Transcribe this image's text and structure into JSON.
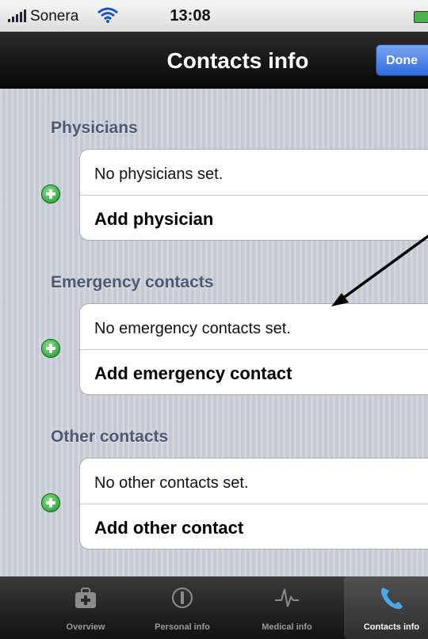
{
  "status_bar": {
    "carrier": "Sonera",
    "time": "13:08"
  },
  "nav": {
    "title": "Contacts info",
    "done_label": "Done"
  },
  "sections": [
    {
      "title": "Physicians",
      "empty_text": "No physicians set.",
      "add_label": "Add physician"
    },
    {
      "title": "Emergency contacts",
      "empty_text": "No emergency contacts set.",
      "add_label": "Add emergency contact"
    },
    {
      "title": "Other contacts",
      "empty_text": "No other contacts set.",
      "add_label": "Add other contact"
    }
  ],
  "tabs": [
    {
      "label": "Overview",
      "icon": "first-aid-kit-icon"
    },
    {
      "label": "Personal info",
      "icon": "info-icon"
    },
    {
      "label": "Medical info",
      "icon": "heartbeat-icon"
    },
    {
      "label": "Contacts info",
      "icon": "phone-icon",
      "active": true
    }
  ],
  "colors": {
    "section_title": "#4d5874",
    "add_icon": "#1f9a2a",
    "done_button": "#2f6be0"
  }
}
